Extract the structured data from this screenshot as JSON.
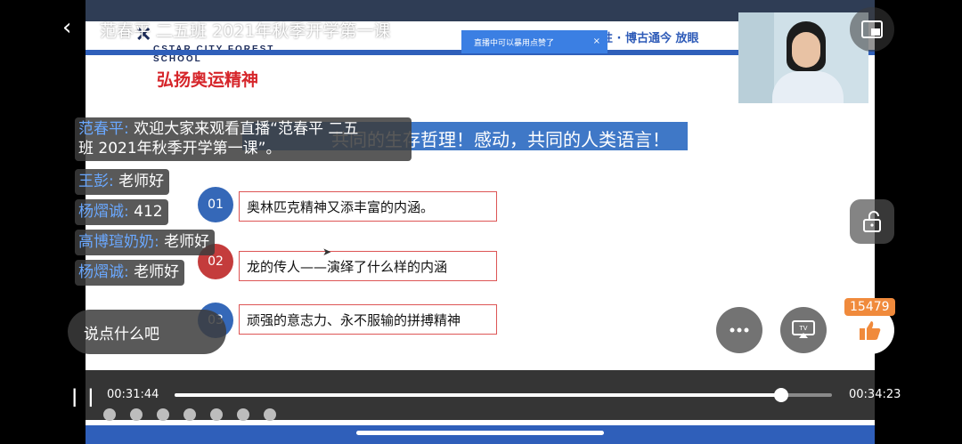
{
  "header": {
    "title": "范春平 二五班 2021年秋季开学第一课",
    "school_logo_text": "CSTAR CITY FOREST SCHOOL",
    "slogan": "释放天性 · 博古通今 放眼"
  },
  "notice": {
    "text": "直播中可以暴用点赞了",
    "close": "×"
  },
  "slide": {
    "title": "弘扬奥运精神",
    "banner": "共同的生存哲理！感动，共同的人类语言！",
    "bullets": [
      {
        "num": "01",
        "text": "奥林匹克精神又添丰富的内涵。",
        "color": "#3568b8"
      },
      {
        "num": "02",
        "text": "龙的传人——演绎了什么样的内涵",
        "color": "#c43c3c"
      },
      {
        "num": "03",
        "text": "顽强的意志力、永不服输的拼搏精神",
        "color": "#3568b8"
      }
    ]
  },
  "chat": [
    {
      "name": "范春平:",
      "msg": " 欢迎大家来观看直播“范春平 二五",
      "msg2": "班 2021年秋季开学第一课”。"
    },
    {
      "name": "王彭:",
      "msg": " 老师好"
    },
    {
      "name": "杨熠诚:",
      "msg": " 412"
    },
    {
      "name": "高博瑄奶奶:",
      "msg": " 老师好"
    },
    {
      "name": "杨熠诚:",
      "msg": " 老师好"
    }
  ],
  "input": {
    "placeholder": "说点什么吧"
  },
  "like_count": "15479",
  "player": {
    "current_time": "00:31:44",
    "total_time": "00:34:23",
    "progress": 0.923
  },
  "icons": {
    "back": "back-arrow-icon",
    "screen": "screen-mode-icon",
    "lock": "unlock-icon",
    "more": "more-icon",
    "tv": "tv-cast-icon",
    "like": "thumbs-up-icon",
    "pause": "pause-icon"
  }
}
